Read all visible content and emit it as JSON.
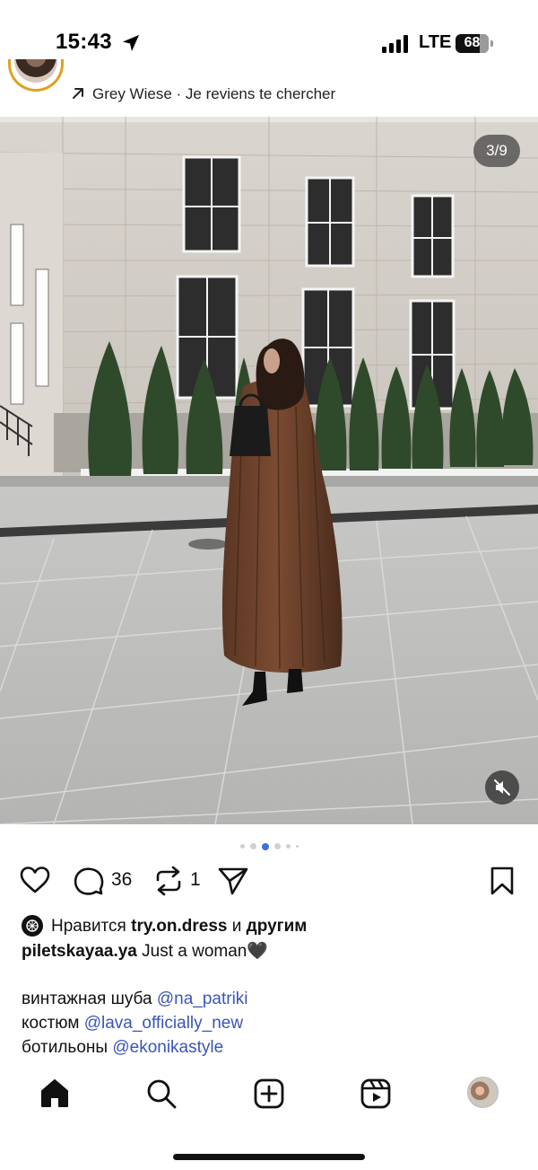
{
  "status_bar": {
    "time": "15:43",
    "network": "LTE",
    "battery": "68",
    "location_icon": "location-arrow-icon",
    "signal_icon": "signal-bars-icon"
  },
  "post": {
    "audio_icon": "arrow-up-right-icon",
    "audio_label": "Grey Wiese · Je reviens te chercher",
    "counter": "3/9",
    "mute_icon": "speaker-muted-icon",
    "carousel": {
      "count": 5,
      "active_index": 2
    }
  },
  "actions": {
    "like_icon": "heart-icon",
    "comment_icon": "comment-icon",
    "comment_count": "36",
    "repost_icon": "repost-icon",
    "repost_count": "1",
    "share_icon": "send-icon",
    "save_icon": "bookmark-icon"
  },
  "caption": {
    "likes_prefix": "Нравится",
    "likes_user": "try.on.dress",
    "likes_and": "и",
    "likes_others": "другим",
    "author": "piletskayaa.ya",
    "text": "Just a woman🖤",
    "lines": [
      {
        "label": "винтажная шуба",
        "mention": "@na_patriki"
      },
      {
        "label": "костюм",
        "mention": "@lava_officially_new"
      },
      {
        "label": "ботильоны",
        "mention": "@ekonikastyle"
      }
    ]
  },
  "nav": {
    "home_icon": "home-icon",
    "search_icon": "search-icon",
    "create_icon": "create-post-icon",
    "reels_icon": "reels-icon",
    "profile_icon": "profile-avatar"
  },
  "colors": {
    "mention": "#3a55b8",
    "active_dot": "#3b6fe0",
    "story_ring": "#e0a020"
  }
}
